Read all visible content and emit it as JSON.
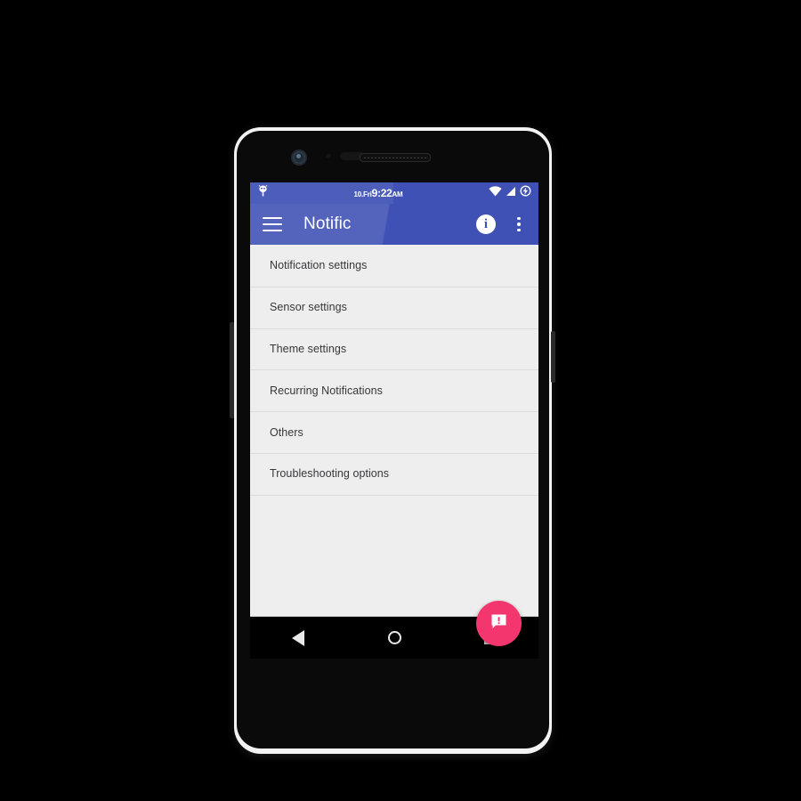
{
  "device": {
    "name": "android-phone",
    "hardware": {
      "front_camera": "front-camera",
      "proximity_sensor": "proximity-sensor",
      "earpiece": "earpiece-speaker",
      "volume_rocker": "volume-rocker",
      "power_button": "power-button"
    }
  },
  "status_bar": {
    "background_color": "#3f51b5",
    "notification_icon": "android-notification-icon",
    "date": "10.Fri",
    "time": "9:22",
    "ampm": "AM",
    "wifi_icon": "wifi-icon",
    "signal_icon": "cell-signal-icon",
    "battery_icon": "battery-charging-icon"
  },
  "app_bar": {
    "background_color": "#3f51b5",
    "menu_icon": "hamburger-menu-icon",
    "title": "Notific",
    "info_icon": "info-icon",
    "info_glyph": "i",
    "overflow_icon": "overflow-menu-icon"
  },
  "main": {
    "background_color": "#eeeeee",
    "items": [
      {
        "label": "Notification settings"
      },
      {
        "label": "Sensor settings"
      },
      {
        "label": "Theme settings"
      },
      {
        "label": "Recurring Notifications"
      },
      {
        "label": "Others"
      },
      {
        "label": "Troubleshooting options"
      }
    ]
  },
  "fab": {
    "name": "feedback-fab",
    "color": "#f4366e",
    "icon": "message-alert-icon"
  },
  "nav_bar": {
    "background_color": "#000000",
    "back_icon": "back-triangle-icon",
    "home_icon": "home-circle-icon",
    "recents_icon": "recents-square-icon"
  }
}
